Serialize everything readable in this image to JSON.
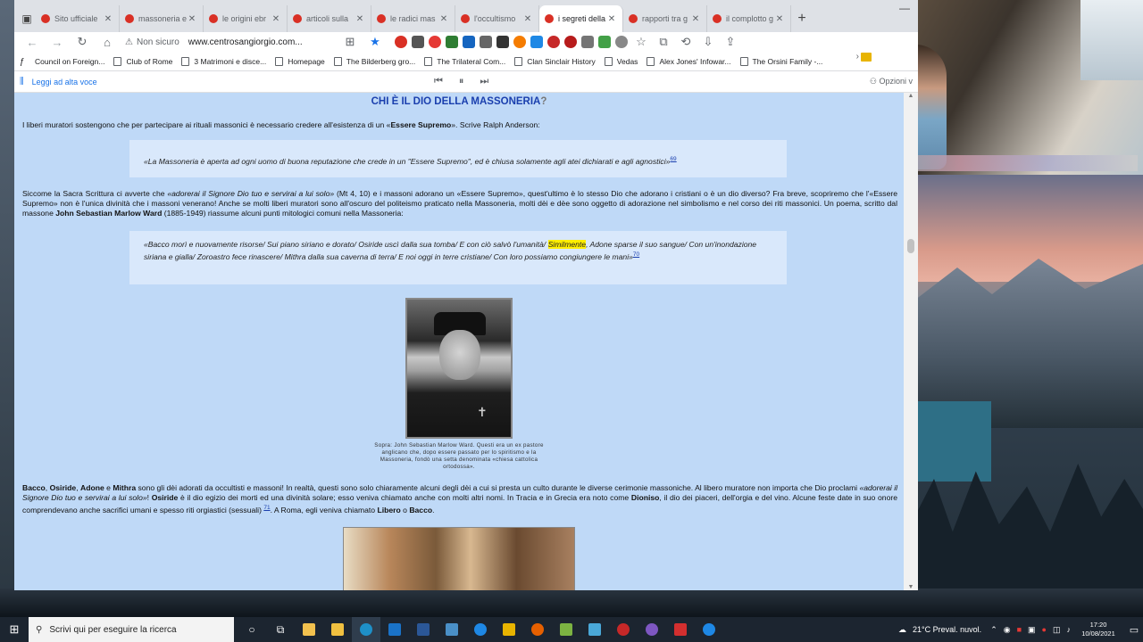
{
  "browser": {
    "tabs": [
      {
        "title": "Sito ufficiale"
      },
      {
        "title": "massoneria e"
      },
      {
        "title": "le origini ebr"
      },
      {
        "title": "articoli sulla"
      },
      {
        "title": "le radici mas"
      },
      {
        "title": "l'occultismo"
      },
      {
        "title": "i segreti della"
      },
      {
        "title": "rapporti tra g"
      },
      {
        "title": "il complotto g"
      }
    ],
    "active_tab_index": 6,
    "new_tab": "+",
    "security_label": "Non sicuro",
    "url": "www.centrosangiorgio.com...",
    "bookmarks": [
      "Council on Foreign...",
      "Club of Rome",
      "3 Matrimoni e disce...",
      "Homepage",
      "The Bilderberg gro...",
      "The Trilateral Com...",
      "Clan Sinclair History",
      "Vedas",
      "Alex Jones' Infowar...",
      "The Orsini Family -..."
    ],
    "read_aloud": {
      "label": "Leggi ad alta voce",
      "options_label": "Opzioni v"
    }
  },
  "content": {
    "title": "CHI È IL DIO DELLA MASSONERIA",
    "title_q": "?",
    "p1_pre": "I liberi muratori sostengono che per partecipare ai rituali massonici è necessario credere all'esistenza di un «",
    "p1_bold": "Essere Supremo",
    "p1_post": "». Scrive Ralph Anderson:",
    "quote1": "«La Massoneria è aperta ad ogni uomo di buona reputazione che crede in un \"Essere Supremo\", ed è chiusa solamente agli atei dichiarati e agli agnostici»",
    "quote1_ref": "69",
    "p2_a": " Siccome la Sacra Scrittura ci avverte che ",
    "p2_ital": "«adorerai il Signore Dio tuo e servirai a lui solo»",
    "p2_b": " (Mt 4, 10) e i massoni adorano un «Essere Supremo», quest'ultimo è lo stesso Dio che adorano i cristiani o è un dio diverso? Fra breve, scopriremo che l'«Essere Supremo» non è l'unica divinità che i massoni venerano! Anche se molti liberi muratori sono all'oscuro del politeismo praticato nella Massoneria, molti dèi e dèe sono oggetto di adorazione nel simbolismo e nel corso dei riti massonici. Un poema, scritto dal massone ",
    "p2_bold": "John Sebastian Marlow Ward",
    "p2_c": " (1885-1949) riassume alcuni punti mitologici comuni nella Massoneria:",
    "quote2_a": "«Bacco morì e nuovamente risorse/ Sui piano siriano e dorato/ Osiride uscì dalla sua tomba/ E con ciò salvò l'umanità/ ",
    "quote2_hl": "Similmente",
    "quote2_b": ", Adone sparse il suo sangue/ Con un'inondazione siriana e gialla/ Zoroastro fece rinascere/ Mithra dalla sua caverna di terra/ E noi oggi in terre cristiane/ Con loro possiamo congiungere le mani»",
    "quote2_ref": "70",
    "caption": "Sopra: John Sebastian Marlow Ward. Questi era un ex pastore anglicano che, dopo essere passato per lo spiritismo e la Massoneria, fondò una setta denominata «chiesa cattolica ortodossa».",
    "p3_b1": "Bacco",
    "p3_s1": ", ",
    "p3_b2": "Osiride",
    "p3_s2": ", ",
    "p3_b3": "Adone",
    "p3_s3": " e ",
    "p3_b4": "Mithra",
    "p3_a": " sono gli dèi adorati da occultisti e massoni! In realtà, questi sono solo chiaramente alcuni degli dèi a cui si presta un culto durante le diverse cerimonie massoniche. Al libero muratore non importa che Dio proclami ",
    "p3_ital": "«adorerai il Signore Dio tuo e servirai a lui solo»",
    "p3_b": "! ",
    "p3_b5": "Osiride",
    "p3_c": " è il dio egizio dei morti ed una divinità solare; esso veniva chiamato anche con molti altri nomi. In Tracia e in Grecia era noto come ",
    "p3_b6": "Dioniso",
    "p3_d": ", il dio dei piaceri, dell'orgia e del vino. Alcune feste date in suo onore comprendevano anche sacrifici umani e spesso riti orgiastici (sessuali) ",
    "p3_ref": "71",
    "p3_e": ". A Roma, egli veniva chiamato ",
    "p3_b7": "Libero",
    "p3_f": " o ",
    "p3_b8": "Bacco",
    "p3_g": "."
  },
  "taskbar": {
    "search_placeholder": "Scrivi qui per eseguire la ricerca",
    "weather": "21°C  Preval. nuvol.",
    "time": "17:20",
    "date": "10/08/2021"
  }
}
